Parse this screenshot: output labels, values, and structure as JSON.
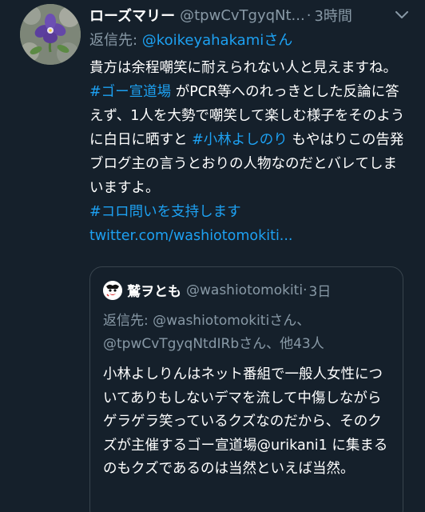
{
  "tweet": {
    "name": "ローズマリー",
    "handle": "@tpwCvTgyqNt...",
    "separator": "·",
    "time": "3時間",
    "reply_prefix": "返信先: ",
    "reply_handle": "@koikeyahakami",
    "reply_suffix": "さん",
    "body": {
      "t1": "貴方は余程嘲笑に耐えられない人と見えますね。",
      "tag1": "#ゴー宣道場",
      "t2": "がPCR等へのれっきとした反論に答えず、1人を大勢で嘲笑して楽しむ様子をそのように白日に晒すと",
      "tag2": "#小林よしのり",
      "t3": "もやはりこの告発ブログ主の言うとおりの人物なのだとバレてしまいますよ。",
      "tag3": "#コロ問いを支持します",
      "url": "twitter.com/washiotomokiti..."
    }
  },
  "quoted": {
    "name": "鷲ヲとも",
    "handle": "@washiotomokiti",
    "separator": "·",
    "time": "3日",
    "reply_line": "返信先: @washiotomokitiさん、@tpwCvTgyqNtdIRbさん、他43人",
    "body": "小林よしりんはネット番組で一般人女性についてありもしないデマを流して中傷しながらゲラゲラ笑っているクズなのだから、そのクズが主催するゴー宣道場@urikani1 に集まるのもクズであるのは当然といえば当然。"
  },
  "colors": {
    "background": "#15202b",
    "accent": "#1da1f2",
    "secondary_text": "#8899a6",
    "border": "#38444d"
  }
}
